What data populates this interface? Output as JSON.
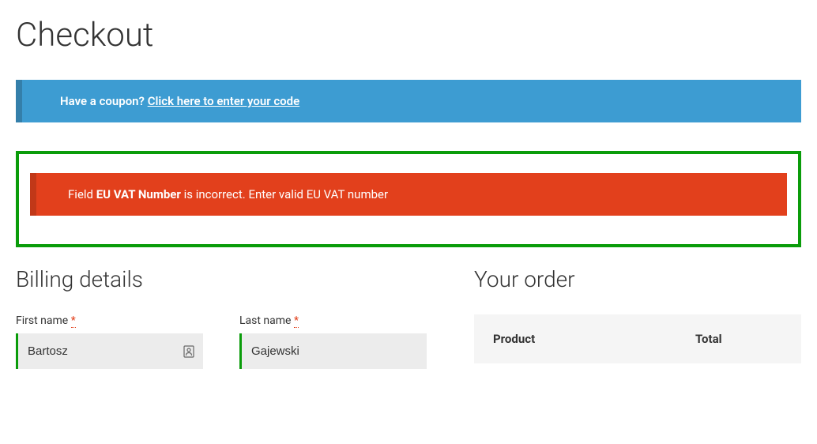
{
  "page": {
    "title": "Checkout"
  },
  "coupon": {
    "prompt": "Have a coupon?",
    "link_text": "Click here to enter your code"
  },
  "error": {
    "prefix": "Field ",
    "field_name": "EU VAT Number",
    "message": " is incorrect. Enter valid EU VAT number"
  },
  "billing": {
    "title": "Billing details",
    "first_name": {
      "label": "First name",
      "value": "Bartosz"
    },
    "last_name": {
      "label": "Last name",
      "value": "Gajewski"
    }
  },
  "order": {
    "title": "Your order",
    "headers": {
      "product": "Product",
      "total": "Total"
    }
  },
  "required": "*"
}
